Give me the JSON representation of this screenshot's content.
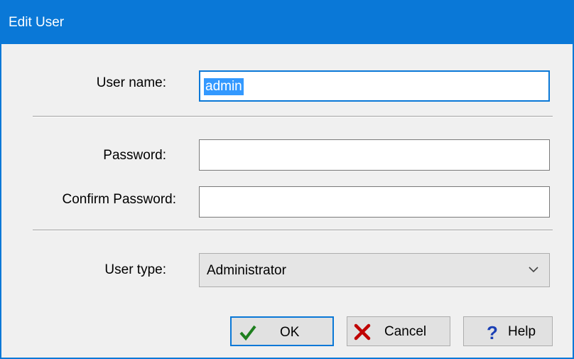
{
  "window": {
    "title": "Edit User"
  },
  "form": {
    "user_name_label": "User name:",
    "user_name_value": "admin",
    "password_label": "Password:",
    "password_value": "",
    "confirm_label": "Confirm Password:",
    "confirm_value": "",
    "user_type_label": "User type:",
    "user_type_value": "Administrator"
  },
  "buttons": {
    "ok": {
      "label": "OK",
      "icon": "checkmark-icon"
    },
    "cancel": {
      "label": "Cancel",
      "icon": "x-cross-icon"
    },
    "help": {
      "label": "Help",
      "icon": "question-mark-icon"
    }
  },
  "colors": {
    "accent": "#0a78d7",
    "selection": "#3399ff",
    "ok_icon": "#1e7f1e",
    "cancel_icon": "#c00000",
    "help_icon": "#1a3fb5"
  }
}
